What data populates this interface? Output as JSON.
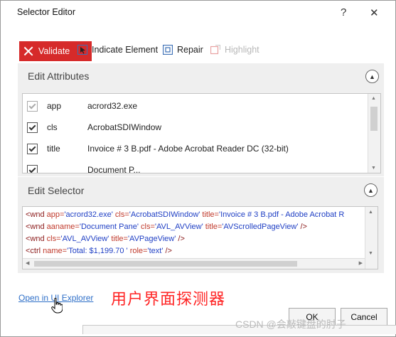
{
  "window": {
    "title": "Selector Editor",
    "help_label": "?",
    "close_label": "✕"
  },
  "toolbar": {
    "validate_label": "Validate",
    "indicate_label": "Indicate Element",
    "repair_label": "Repair",
    "highlight_label": "Highlight"
  },
  "edit_attributes": {
    "title": "Edit Attributes",
    "rows": [
      {
        "checked": true,
        "enabled": false,
        "name": "app",
        "value": "acrord32.exe"
      },
      {
        "checked": true,
        "enabled": true,
        "name": "cls",
        "value": "AcrobatSDIWindow"
      },
      {
        "checked": true,
        "enabled": true,
        "name": "title",
        "value": "Invoice # 3 B.pdf - Adobe Acrobat Reader DC (32-bit)"
      },
      {
        "checked": true,
        "enabled": true,
        "name": "",
        "value": "Document P..."
      }
    ]
  },
  "edit_selector": {
    "title": "Edit Selector",
    "lines": [
      {
        "tag": "<wnd ",
        "parts": [
          [
            "app=",
            "'acrord32.exe'"
          ],
          [
            " cls=",
            "'AcrobatSDIWindow'"
          ],
          [
            " title=",
            "'Invoice # 3 B.pdf - Adobe Acrobat R"
          ]
        ],
        "end": ""
      },
      {
        "tag": "<wnd ",
        "parts": [
          [
            "aaname=",
            "'Document Pane'"
          ],
          [
            " cls=",
            "'AVL_AVView'"
          ],
          [
            " title=",
            "'AVScrolledPageView'"
          ]
        ],
        "end": " />"
      },
      {
        "tag": "<wnd ",
        "parts": [
          [
            "cls=",
            "'AVL_AVView'"
          ],
          [
            " title=",
            "'AVPageView'"
          ]
        ],
        "end": " />"
      },
      {
        "tag": "<ctrl ",
        "parts": [
          [
            "name=",
            "'Total:  $1,199.70  '"
          ],
          [
            " role=",
            "'text'"
          ]
        ],
        "end": " />"
      }
    ]
  },
  "footer": {
    "link_label": "Open in UI Explorer",
    "annotation": "用户界面探测器",
    "ok_label": "OK",
    "cancel_label": "Cancel",
    "watermark": "CSDN @会敲键盘的肘子"
  },
  "colors": {
    "validate_bg": "#d62a2a",
    "link": "#2e6fc8",
    "annotation": "#ff2424"
  }
}
